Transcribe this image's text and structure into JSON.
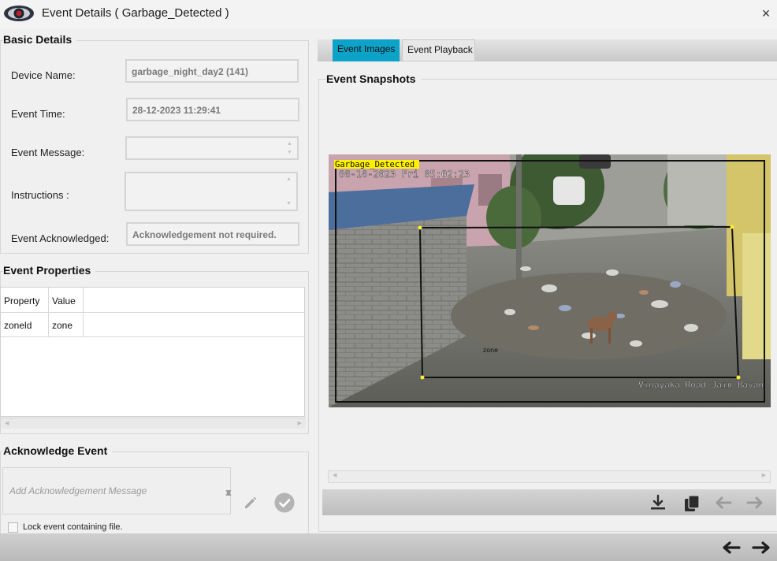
{
  "window": {
    "title": "Event Details ( Garbage_Detected )",
    "close_glyph": "×",
    "logo_icon": "eye-logo-icon"
  },
  "basic_details": {
    "section_title": "Basic Details",
    "device_name_label": "Device Name:",
    "device_name_value": "garbage_night_day2 (141)",
    "event_time_label": "Event Time:",
    "event_time_value": "28-12-2023 11:29:41",
    "event_message_label": "Event Message:",
    "event_message_value": "",
    "instructions_label": "Instructions :",
    "instructions_value": "",
    "event_acknowledged_label": "Event Acknowledged:",
    "event_acknowledged_value": "Acknowledgement not required."
  },
  "event_properties": {
    "section_title": "Event Properties",
    "columns": [
      "Property",
      "Value"
    ],
    "rows": [
      {
        "property": "zoneld",
        "value": "zone"
      }
    ]
  },
  "acknowledge_event": {
    "section_title": "Acknowledge Event",
    "placeholder": "Add Acknowledgement Message",
    "lock_label": "Lock event containing file.",
    "edit_icon": "pencil-icon",
    "confirm_icon": "check-circle-icon"
  },
  "tabs": [
    {
      "label": "Event Images",
      "active": true
    },
    {
      "label": "Event Playback",
      "active": false
    }
  ],
  "snapshots": {
    "section_title": "Event Snapshots",
    "detection_label": "Garbage_Detected",
    "camera_timestamp": "08-18-2023 Fri 05:02:23",
    "zone_label": "zone",
    "camera_location": "Vinayaka Road Jain Bavan"
  },
  "actions": [
    "download-icon",
    "copy-icon",
    "arrow-left-icon",
    "arrow-right-icon"
  ],
  "colors": {
    "accent_tab": "#0da2c8",
    "detection_label_bg": "#fff200",
    "zone_vertex": "#ffee33"
  }
}
